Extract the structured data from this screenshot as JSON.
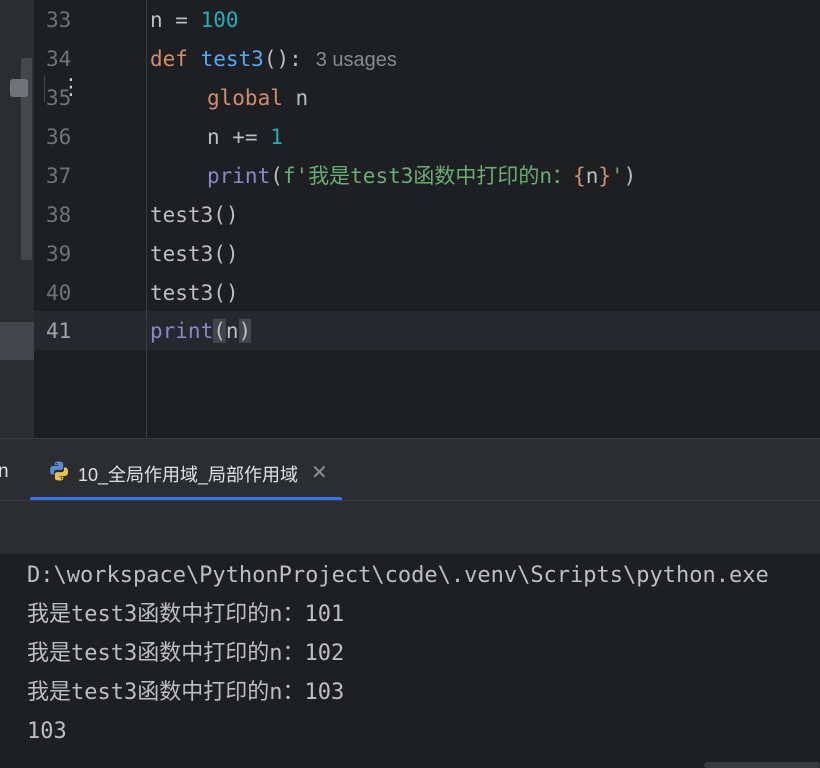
{
  "editor": {
    "lines": [
      {
        "no": "33"
      },
      {
        "no": "34"
      },
      {
        "no": "35"
      },
      {
        "no": "36"
      },
      {
        "no": "37"
      },
      {
        "no": "38"
      },
      {
        "no": "39"
      },
      {
        "no": "40"
      },
      {
        "no": "41"
      }
    ],
    "code": {
      "l33_n": "n = ",
      "l33_val": "100",
      "l34_def": "def",
      "l34_fn": "test3",
      "l34_rest": "():",
      "l34_hint": "3 usages",
      "l35_kw": "global",
      "l35_rest": " n",
      "l36_rest": "n += ",
      "l36_val": "1",
      "l37_print": "print",
      "l37_open": "(",
      "l37_str1": "f'我是test3函数中打印的n：",
      "l37_brace1": "{",
      "l37_var": "n",
      "l37_brace2": "}",
      "l37_str2": "'",
      "l37_close": ")",
      "l38": "test3()",
      "l39": "test3()",
      "l40": "test3()",
      "l41_print": "print",
      "l41_open": "(",
      "l41_arg": "n",
      "l41_close": ")"
    }
  },
  "tool_window": {
    "prev_tab_tail": "n",
    "run_tab_label": "10_全局作用域_局部作用域",
    "close_glyph": "✕",
    "more_glyph": "⋮",
    "accent": "#3574f0"
  },
  "console": {
    "lines": [
      "D:\\workspace\\PythonProject\\code\\.venv\\Scripts\\python.exe",
      "我是test3函数中打印的n：101",
      "我是test3函数中打印的n：102",
      "我是test3函数中打印的n：103",
      "103"
    ]
  }
}
